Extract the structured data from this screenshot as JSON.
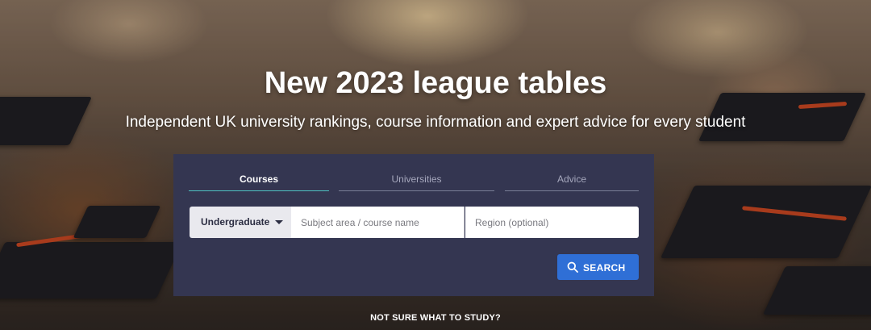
{
  "hero": {
    "title": "New 2023 league tables",
    "subtitle": "Independent UK university rankings, course information and expert advice for every student"
  },
  "search": {
    "tabs": [
      {
        "label": "Courses",
        "active": true
      },
      {
        "label": "Universities",
        "active": false
      },
      {
        "label": "Advice",
        "active": false
      }
    ],
    "level": {
      "selected": "Undergraduate",
      "icon": "caret-down-icon"
    },
    "subject_placeholder": "Subject area / course name",
    "region_placeholder": "Region (optional)",
    "button_label": "SEARCH",
    "button_icon": "search-icon"
  },
  "footer_link": "NOT SURE WHAT TO STUDY?",
  "colors": {
    "panel": "#343651",
    "active_tab_underline": "#4fc1c1",
    "button": "#2f6fd6"
  }
}
